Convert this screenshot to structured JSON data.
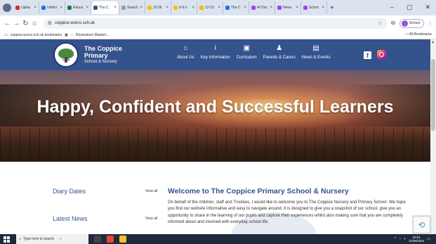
{
  "browser": {
    "tabs": [
      {
        "title": "Uploa",
        "color": "#d93025"
      },
      {
        "title": "Unlimi",
        "color": "#1a73e8"
      },
      {
        "title": "Educa",
        "color": "#188038"
      },
      {
        "title": "The C",
        "color": "#34528c",
        "active": true
      },
      {
        "title": "Search",
        "color": "#9aa0a6"
      },
      {
        "title": "10.06",
        "color": "#fbbc04"
      },
      {
        "title": "6-6-2",
        "color": "#fbbc04"
      },
      {
        "title": "12-10",
        "color": "#fbbc04"
      },
      {
        "title": "The C",
        "color": "#1a73e8"
      },
      {
        "title": "AI Doc",
        "color": "#a142f4"
      },
      {
        "title": "News",
        "color": "#a142f4"
      },
      {
        "title": "Schoo",
        "color": "#a142f4"
      }
    ],
    "url": "coppice.worcs.sch.uk",
    "bookmarks_label": "coppice.worcs.sch.uk bookmarks",
    "bookmark_item": "Rosendove Masteri...",
    "all_bookmarks": "All Bookmarks",
    "profile_label": "School"
  },
  "site": {
    "name_line1": "The Coppice",
    "name_line2": "Primary",
    "name_line3": "School & Nursery",
    "logo_text": "CPS",
    "nav": [
      {
        "label": "About Us",
        "icon": "house-icon",
        "glyph": "⌂"
      },
      {
        "label": "Key Information",
        "icon": "info-icon",
        "glyph": "i"
      },
      {
        "label": "Curriculum",
        "icon": "id-card-icon",
        "glyph": "▣"
      },
      {
        "label": "Parents & Carers",
        "icon": "person-icon",
        "glyph": "♟"
      },
      {
        "label": "News & Events",
        "icon": "calendar-icon",
        "glyph": "▤"
      }
    ],
    "facebook_glyph": "f"
  },
  "hero": {
    "title": "Happy, Confident and Successful Learners"
  },
  "content": {
    "diary_heading": "Diary Dates",
    "news_heading": "Latest News",
    "view_all": "View all",
    "welcome_heading": "Welcome to The Coppice Primary School & Nursery",
    "welcome_text": "On behalf of the children, staff and Trustees, I would like to welcome you to The Coppice Nursery and Primary School. We hope you find our website informative and easy to navigate around. It is designed to give you a snapshot of our school, give you an opportunity to share in the learning of our pupils and capture their experiences whilst also making sure that you are completely informed about and involved with everyday school life."
  },
  "taskbar": {
    "search_placeholder": "Type here to search",
    "time": "20:51",
    "date": "11/06/2024"
  }
}
